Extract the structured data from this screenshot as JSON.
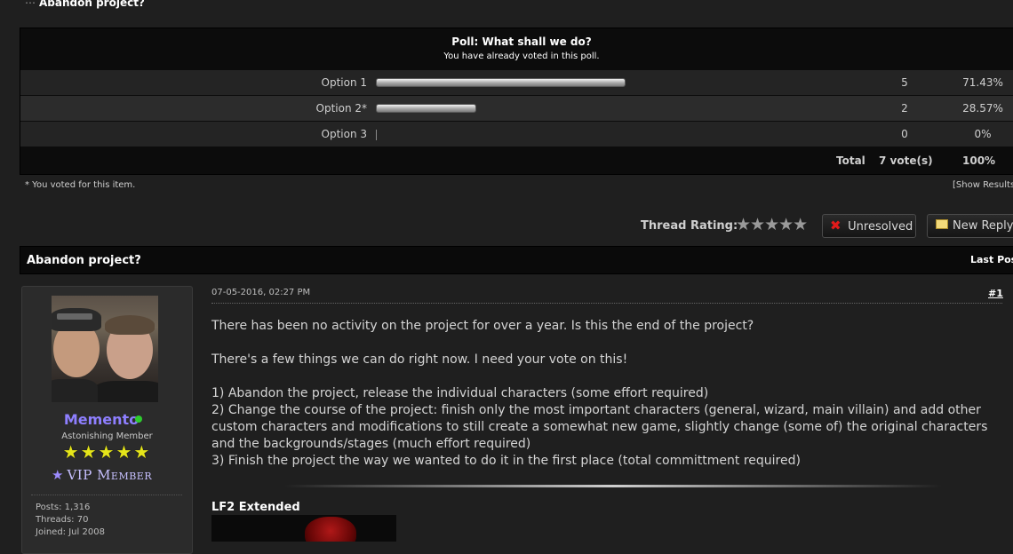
{
  "thread": {
    "title": "Abandon project?",
    "last_post_label": "Last Post"
  },
  "poll": {
    "question": "Poll: What shall we do?",
    "status": "You have already voted in this poll.",
    "options": [
      {
        "label": "Option 1",
        "votes": "5",
        "percent": "71.43%",
        "fill": 0.7143
      },
      {
        "label": "Option 2*",
        "votes": "2",
        "percent": "28.57%",
        "fill": 0.2857
      },
      {
        "label": "Option 3",
        "votes": "0",
        "percent": "0%",
        "fill": 0
      }
    ],
    "total_label": "Total",
    "total_votes": "7 vote(s)",
    "total_percent": "100%",
    "footnote": "* You voted for this item.",
    "show_results": "[Show Results"
  },
  "rating": {
    "label": "Thread Rating:",
    "stars": "★★★★★"
  },
  "buttons": {
    "unresolved": "Unresolved",
    "new_reply": "New Reply"
  },
  "user": {
    "name": "Memento",
    "title": "Astonishing Member",
    "stars": "★★★★★",
    "badge": "VIP Member",
    "posts": "Posts: 1,316",
    "threads": "Threads: 70",
    "joined": "Joined: Jul 2008"
  },
  "post": {
    "date": "07-05-2016, 02:27 PM",
    "number": "#1",
    "p1": "There has been no activity on the project for over a year. Is this the end of the project?",
    "p2": "There's a few things we can do right now. I need your vote on this!",
    "l1": "1) Abandon the project, release the individual characters (some effort required)",
    "l2": "2) Change the course of the project: finish only the most important characters (general, wizard, main villain) and add other custom characters and modifications to still create a somewhat new game, slightly change (some of) the original characters and the backgrounds/stages (much effort required)",
    "l3": "3) Finish the project the way we wanted to do it in the first place (total committment required)",
    "signature_title": "LF2 Extended"
  },
  "colors": {
    "username": "#8e7fff",
    "online": "#2ecc2e",
    "unresolved_icon": "#e21a1a",
    "rank_stars": "#e5e51a"
  }
}
